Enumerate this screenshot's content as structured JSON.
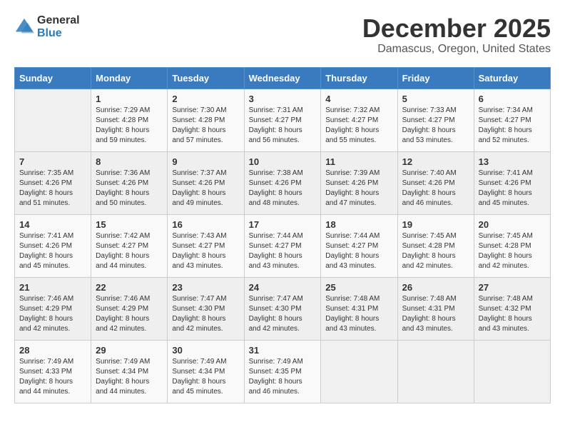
{
  "header": {
    "logo_general": "General",
    "logo_blue": "Blue",
    "title": "December 2025",
    "subtitle": "Damascus, Oregon, United States"
  },
  "calendar": {
    "weekdays": [
      "Sunday",
      "Monday",
      "Tuesday",
      "Wednesday",
      "Thursday",
      "Friday",
      "Saturday"
    ],
    "weeks": [
      [
        {
          "day": "",
          "info": ""
        },
        {
          "day": "1",
          "info": "Sunrise: 7:29 AM\nSunset: 4:28 PM\nDaylight: 8 hours\nand 59 minutes."
        },
        {
          "day": "2",
          "info": "Sunrise: 7:30 AM\nSunset: 4:28 PM\nDaylight: 8 hours\nand 57 minutes."
        },
        {
          "day": "3",
          "info": "Sunrise: 7:31 AM\nSunset: 4:27 PM\nDaylight: 8 hours\nand 56 minutes."
        },
        {
          "day": "4",
          "info": "Sunrise: 7:32 AM\nSunset: 4:27 PM\nDaylight: 8 hours\nand 55 minutes."
        },
        {
          "day": "5",
          "info": "Sunrise: 7:33 AM\nSunset: 4:27 PM\nDaylight: 8 hours\nand 53 minutes."
        },
        {
          "day": "6",
          "info": "Sunrise: 7:34 AM\nSunset: 4:27 PM\nDaylight: 8 hours\nand 52 minutes."
        }
      ],
      [
        {
          "day": "7",
          "info": "Sunrise: 7:35 AM\nSunset: 4:26 PM\nDaylight: 8 hours\nand 51 minutes."
        },
        {
          "day": "8",
          "info": "Sunrise: 7:36 AM\nSunset: 4:26 PM\nDaylight: 8 hours\nand 50 minutes."
        },
        {
          "day": "9",
          "info": "Sunrise: 7:37 AM\nSunset: 4:26 PM\nDaylight: 8 hours\nand 49 minutes."
        },
        {
          "day": "10",
          "info": "Sunrise: 7:38 AM\nSunset: 4:26 PM\nDaylight: 8 hours\nand 48 minutes."
        },
        {
          "day": "11",
          "info": "Sunrise: 7:39 AM\nSunset: 4:26 PM\nDaylight: 8 hours\nand 47 minutes."
        },
        {
          "day": "12",
          "info": "Sunrise: 7:40 AM\nSunset: 4:26 PM\nDaylight: 8 hours\nand 46 minutes."
        },
        {
          "day": "13",
          "info": "Sunrise: 7:41 AM\nSunset: 4:26 PM\nDaylight: 8 hours\nand 45 minutes."
        }
      ],
      [
        {
          "day": "14",
          "info": "Sunrise: 7:41 AM\nSunset: 4:26 PM\nDaylight: 8 hours\nand 45 minutes."
        },
        {
          "day": "15",
          "info": "Sunrise: 7:42 AM\nSunset: 4:27 PM\nDaylight: 8 hours\nand 44 minutes."
        },
        {
          "day": "16",
          "info": "Sunrise: 7:43 AM\nSunset: 4:27 PM\nDaylight: 8 hours\nand 43 minutes."
        },
        {
          "day": "17",
          "info": "Sunrise: 7:44 AM\nSunset: 4:27 PM\nDaylight: 8 hours\nand 43 minutes."
        },
        {
          "day": "18",
          "info": "Sunrise: 7:44 AM\nSunset: 4:27 PM\nDaylight: 8 hours\nand 43 minutes."
        },
        {
          "day": "19",
          "info": "Sunrise: 7:45 AM\nSunset: 4:28 PM\nDaylight: 8 hours\nand 42 minutes."
        },
        {
          "day": "20",
          "info": "Sunrise: 7:45 AM\nSunset: 4:28 PM\nDaylight: 8 hours\nand 42 minutes."
        }
      ],
      [
        {
          "day": "21",
          "info": "Sunrise: 7:46 AM\nSunset: 4:29 PM\nDaylight: 8 hours\nand 42 minutes."
        },
        {
          "day": "22",
          "info": "Sunrise: 7:46 AM\nSunset: 4:29 PM\nDaylight: 8 hours\nand 42 minutes."
        },
        {
          "day": "23",
          "info": "Sunrise: 7:47 AM\nSunset: 4:30 PM\nDaylight: 8 hours\nand 42 minutes."
        },
        {
          "day": "24",
          "info": "Sunrise: 7:47 AM\nSunset: 4:30 PM\nDaylight: 8 hours\nand 42 minutes."
        },
        {
          "day": "25",
          "info": "Sunrise: 7:48 AM\nSunset: 4:31 PM\nDaylight: 8 hours\nand 43 minutes."
        },
        {
          "day": "26",
          "info": "Sunrise: 7:48 AM\nSunset: 4:31 PM\nDaylight: 8 hours\nand 43 minutes."
        },
        {
          "day": "27",
          "info": "Sunrise: 7:48 AM\nSunset: 4:32 PM\nDaylight: 8 hours\nand 43 minutes."
        }
      ],
      [
        {
          "day": "28",
          "info": "Sunrise: 7:49 AM\nSunset: 4:33 PM\nDaylight: 8 hours\nand 44 minutes."
        },
        {
          "day": "29",
          "info": "Sunrise: 7:49 AM\nSunset: 4:34 PM\nDaylight: 8 hours\nand 44 minutes."
        },
        {
          "day": "30",
          "info": "Sunrise: 7:49 AM\nSunset: 4:34 PM\nDaylight: 8 hours\nand 45 minutes."
        },
        {
          "day": "31",
          "info": "Sunrise: 7:49 AM\nSunset: 4:35 PM\nDaylight: 8 hours\nand 46 minutes."
        },
        {
          "day": "",
          "info": ""
        },
        {
          "day": "",
          "info": ""
        },
        {
          "day": "",
          "info": ""
        }
      ]
    ]
  }
}
